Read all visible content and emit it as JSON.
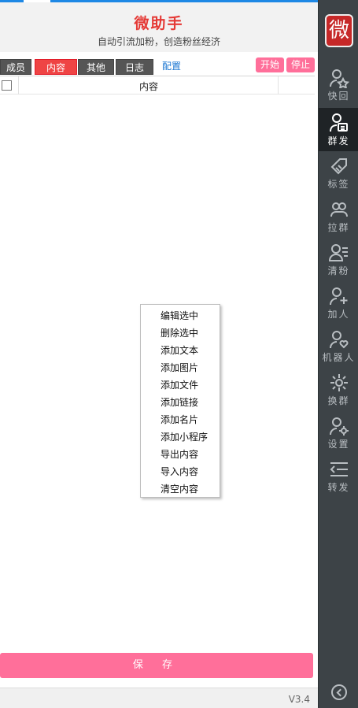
{
  "header": {
    "title": "微助手",
    "subtitle": "自动引流加粉，创造粉丝经济"
  },
  "tabs": {
    "items": [
      {
        "label": "成员",
        "active": false
      },
      {
        "label": "内容",
        "active": true
      },
      {
        "label": "其他",
        "active": false
      },
      {
        "label": "日志",
        "active": false
      }
    ],
    "config_label": "配置",
    "start_label": "开始",
    "stop_label": "停止"
  },
  "table": {
    "columns": [
      "",
      "内容"
    ]
  },
  "context_menu": {
    "items": [
      "编辑选中",
      "删除选中",
      "添加文本",
      "添加图片",
      "添加文件",
      "添加链接",
      "添加名片",
      "添加小程序",
      "导出内容",
      "导入内容",
      "清空内容"
    ]
  },
  "save_label": "保 存",
  "version": "V3.4",
  "sidebar": {
    "logo_text": "微",
    "items": [
      {
        "label": "快回",
        "icon": "user-star-icon",
        "active": false
      },
      {
        "label": "群发",
        "icon": "user-card-icon",
        "active": true
      },
      {
        "label": "标签",
        "icon": "tag-icon",
        "active": false
      },
      {
        "label": "拉群",
        "icon": "group-icon",
        "active": false
      },
      {
        "label": "清粉",
        "icon": "user-list-icon",
        "active": false
      },
      {
        "label": "加人",
        "icon": "user-plus-icon",
        "active": false
      },
      {
        "label": "机器人",
        "icon": "user-heart-icon",
        "active": false
      },
      {
        "label": "换群",
        "icon": "swap-sparkle-icon",
        "active": false
      },
      {
        "label": "设置",
        "icon": "user-gear-icon",
        "active": false
      },
      {
        "label": "转发",
        "icon": "forward-list-icon",
        "active": false
      }
    ]
  },
  "colors": {
    "accent_pink": "#ff6f9a",
    "title_red": "#e53935",
    "active_tab": "#ef4444",
    "sidebar_bg": "#3d4347",
    "link_blue": "#1976d2"
  }
}
